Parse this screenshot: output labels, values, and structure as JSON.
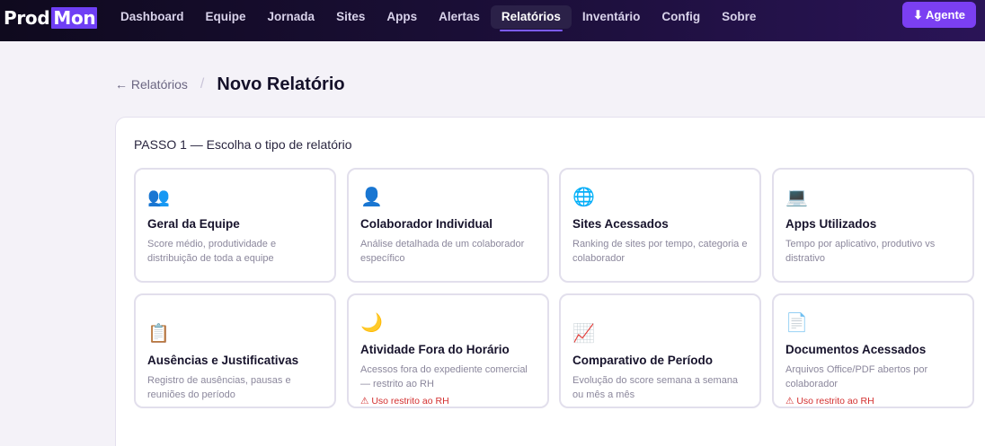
{
  "brand": {
    "name_a": "Prod",
    "name_b": "Mon"
  },
  "nav": {
    "items": [
      "Dashboard",
      "Equipe",
      "Jornada",
      "Sites",
      "Apps",
      "Alertas",
      "Relatórios",
      "Inventário",
      "Config",
      "Sobre"
    ],
    "active": "Relatórios"
  },
  "agent_button": {
    "icon": "⬇",
    "label": "Agente"
  },
  "breadcrumb": {
    "back_label": "← Relatórios",
    "separator": "/",
    "title": "Novo Relatório"
  },
  "step": {
    "title": "PASSO 1 — Escolha o tipo de relatório"
  },
  "cards": [
    {
      "icon": "👥",
      "icon_name": "team-icon",
      "title": "Geral da Equipe",
      "desc": "Score médio, produtividade e distribuição de toda a equipe",
      "tag": ""
    },
    {
      "icon": "👤",
      "icon_name": "person-icon",
      "title": "Colaborador Individual",
      "desc": "Análise detalhada de um colaborador específico",
      "tag": ""
    },
    {
      "icon": "🌐",
      "icon_name": "globe-icon",
      "title": "Sites Acessados",
      "desc": "Ranking de sites por tempo, categoria e colaborador",
      "tag": ""
    },
    {
      "icon": "💻",
      "icon_name": "laptop-icon",
      "title": "Apps Utilizados",
      "desc": "Tempo por aplicativo, produtivo vs distrativo",
      "tag": ""
    },
    {
      "icon": "📋",
      "icon_name": "clipboard-icon",
      "title": "Ausências e Justificativas",
      "desc": "Registro de ausências, pausas e reuniões do período",
      "tag": ""
    },
    {
      "icon": "🌙",
      "icon_name": "moon-icon",
      "title": "Atividade Fora do Horário",
      "desc": "Acessos fora do expediente comercial — restrito ao RH",
      "tag": "⚠ Uso restrito ao RH"
    },
    {
      "icon": "📈",
      "icon_name": "chart-trend-icon",
      "title": "Comparativo de Período",
      "desc": "Evolução do score semana a semana ou mês a mês",
      "tag": ""
    },
    {
      "icon": "📄",
      "icon_name": "document-icon",
      "title": "Documentos Acessados",
      "desc": "Arquivos Office/PDF abertos por colaborador",
      "tag": "⚠ Uso restrito ao RH"
    }
  ],
  "colors": {
    "accent": "#7b3ff2",
    "nav_bg": "#1c0f3a",
    "warning": "#d32f2f"
  }
}
